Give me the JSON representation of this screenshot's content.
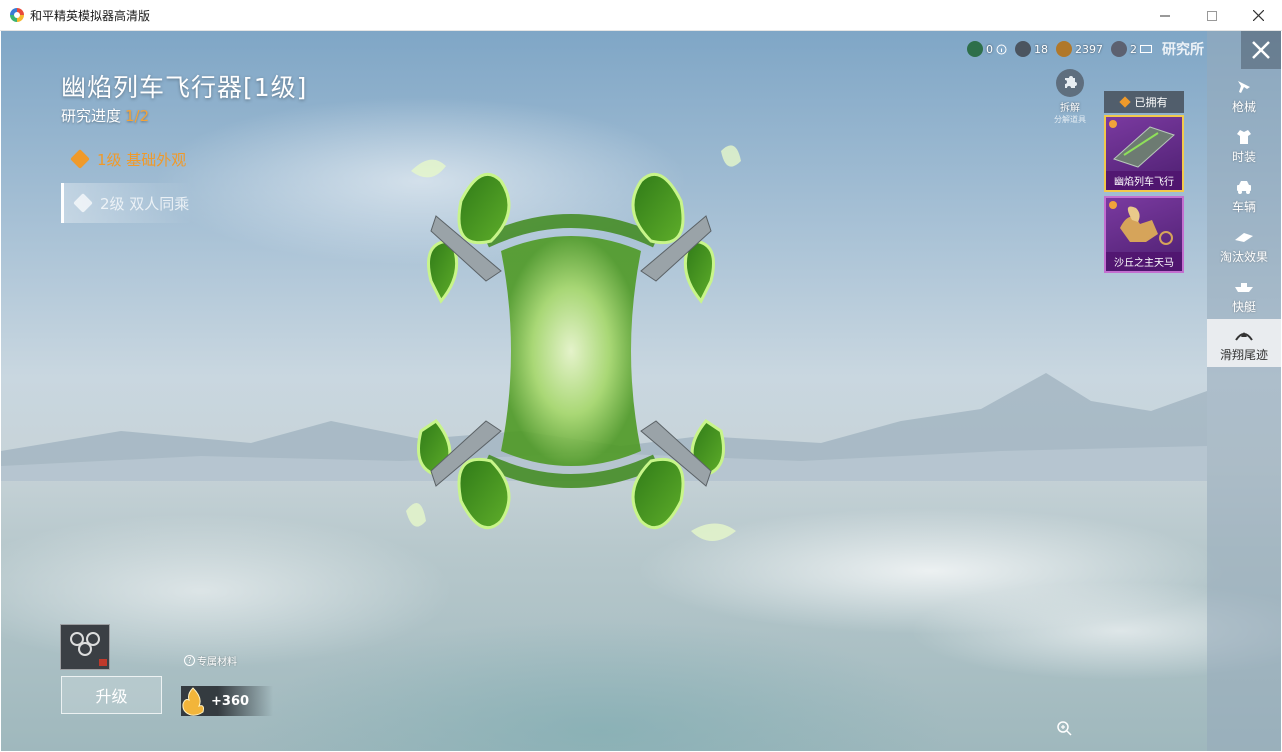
{
  "window": {
    "title": "和平精英模拟器高清版",
    "controls": [
      "minimize",
      "maximize",
      "close"
    ]
  },
  "item": {
    "title": "幽焰列车飞行器[1级]",
    "progress_label": "研究进度",
    "progress_value": "1/2"
  },
  "levels": [
    {
      "label": "1级 基础外观",
      "state": "unlocked"
    },
    {
      "label": "2级 双人同乘",
      "state": "locked"
    }
  ],
  "currencies": [
    {
      "icon": "tier-badge-icon",
      "value": "0"
    },
    {
      "icon": "emblem-icon",
      "value": "18"
    },
    {
      "icon": "coin-icon",
      "value": "2397"
    },
    {
      "icon": "ticket-icon",
      "value": "2"
    }
  ],
  "lab_label": "研究所",
  "decompose": {
    "label": "拆解",
    "sub": "分解道具"
  },
  "owned": {
    "header": "已拥有",
    "items": [
      {
        "label": "幽焰列车飞行"
      },
      {
        "label": "沙丘之主天马"
      }
    ]
  },
  "sidebar": {
    "items": [
      {
        "label": "枪械",
        "icon": "gun-icon"
      },
      {
        "label": "时装",
        "icon": "outfit-icon"
      },
      {
        "label": "车辆",
        "icon": "car-icon"
      },
      {
        "label": "淘汰效果",
        "icon": "elimination-effect-icon"
      },
      {
        "label": "快艇",
        "icon": "speedboat-icon"
      },
      {
        "label": "滑翔尾迹",
        "icon": "glider-trail-icon",
        "active": true
      }
    ]
  },
  "bottom": {
    "upgrade_label": "升级",
    "material_label": "专属材料",
    "material_value": "+360"
  },
  "colors": {
    "accent_orange": "#f09a2a",
    "card_purple": "#7a3aa0",
    "selected_card_border": "#f2c94c",
    "glow_green": "#7ee04a"
  }
}
